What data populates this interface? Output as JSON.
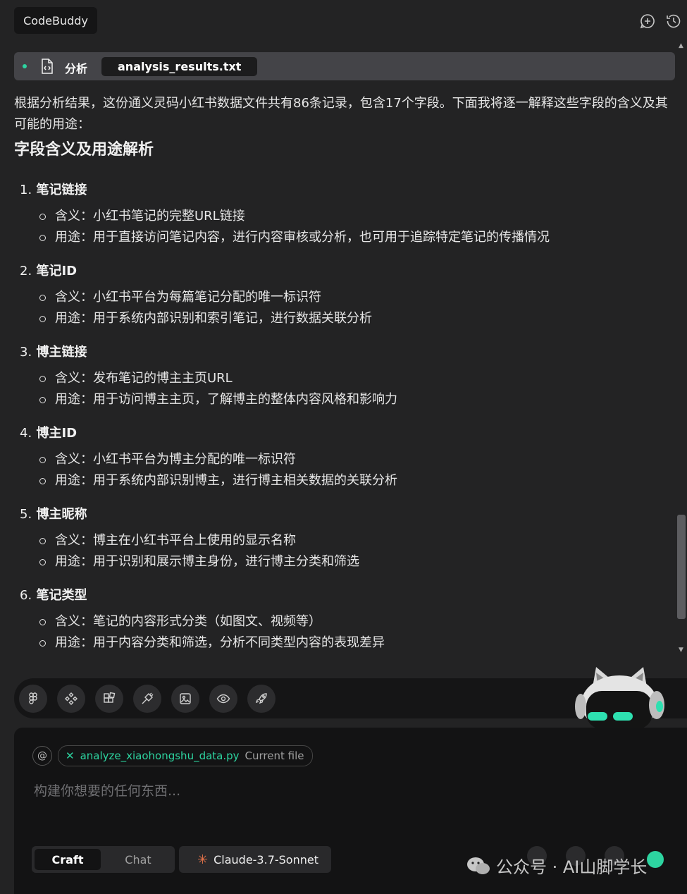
{
  "app": {
    "title": "CodeBuddy"
  },
  "file_bar": {
    "label": "分析",
    "filename": "analysis_results.txt"
  },
  "content": {
    "intro": "根据分析结果，这份通义灵码小红书数据文件共有86条记录，包含17个字段。下面我将逐一解释这些字段的含义及其可能的用途：",
    "heading": "字段含义及用途解析",
    "fields": [
      {
        "num": "1.",
        "name": "笔记链接",
        "items": [
          "含义：小红书笔记的完整URL链接",
          "用途：用于直接访问笔记内容，进行内容审核或分析，也可用于追踪特定笔记的传播情况"
        ]
      },
      {
        "num": "2.",
        "name": "笔记ID",
        "items": [
          "含义：小红书平台为每篇笔记分配的唯一标识符",
          "用途：用于系统内部识别和索引笔记，进行数据关联分析"
        ]
      },
      {
        "num": "3.",
        "name": "博主链接",
        "items": [
          "含义：发布笔记的博主主页URL",
          "用途：用于访问博主主页，了解博主的整体内容风格和影响力"
        ]
      },
      {
        "num": "4.",
        "name": "博主ID",
        "items": [
          "含义：小红书平台为博主分配的唯一标识符",
          "用途：用于系统内部识别博主，进行博主相关数据的关联分析"
        ]
      },
      {
        "num": "5.",
        "name": "博主昵称",
        "items": [
          "含义：博主在小红书平台上使用的显示名称",
          "用途：用于识别和展示博主身份，进行博主分类和筛选"
        ]
      },
      {
        "num": "6.",
        "name": "笔记类型",
        "items": [
          "含义：笔记的内容形式分类（如图文、视频等）",
          "用途：用于内容分类和筛选，分析不同类型内容的表现差异"
        ]
      }
    ]
  },
  "toolbar_icons": [
    "figma-icon",
    "components-icon",
    "blocks-icon",
    "plug-icon",
    "image-icon",
    "eye-icon",
    "rocket-icon"
  ],
  "input": {
    "at_symbol": "@",
    "file_chip": {
      "remove": "✕",
      "filename": "analyze_xiaohongshu_data.py",
      "suffix": "Current file"
    },
    "placeholder": "构建你想要的任何东西..."
  },
  "modes": {
    "active": "Craft",
    "inactive": "Chat"
  },
  "model": {
    "star": "✳",
    "name": "Claude-3.7-Sonnet"
  },
  "watermark": {
    "text": "公众号 · AI山脚学长"
  },
  "colors": {
    "accent": "#2dd4a0",
    "background": "#232324",
    "panel": "#131314",
    "model_star": "#e8744a"
  }
}
